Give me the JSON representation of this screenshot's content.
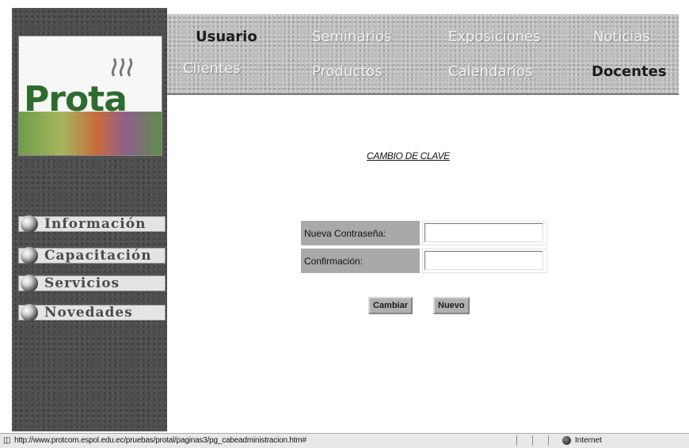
{
  "logo": {
    "text": "Prota"
  },
  "sidebar": {
    "items": [
      {
        "label": "Información"
      },
      {
        "label": "Capacitación"
      },
      {
        "label": "Servicios"
      },
      {
        "label": "Novedades"
      }
    ]
  },
  "topnav": {
    "row1": [
      {
        "label": "Usuario"
      },
      {
        "label": "Seminarios"
      },
      {
        "label": "Exposiciones"
      },
      {
        "label": "Noticias"
      }
    ],
    "row2": [
      {
        "label": "Clientes"
      },
      {
        "label": "Productos"
      },
      {
        "label": "Calendarios"
      },
      {
        "label": "Docentes"
      }
    ]
  },
  "form": {
    "title": "CAMBIO DE CLAVE",
    "new_password_label": "Nueva Contraseña:",
    "new_password_value": "",
    "confirm_label": "Confirmación:",
    "confirm_value": "",
    "submit_label": "Cambiar",
    "new_label": "Nuevo"
  },
  "statusbar": {
    "url": "http://www.protcom.espol.edu.ec/pruebas/protal/paginas3/pg_cabeadministracion.htm#",
    "zone": "Internet"
  },
  "colors": {
    "sidebar_bg": "#4f4f4f",
    "topnav_bg": "#bdbdbd",
    "label_bg": "#a9a9a9",
    "button_bg": "#b0b0b0"
  }
}
